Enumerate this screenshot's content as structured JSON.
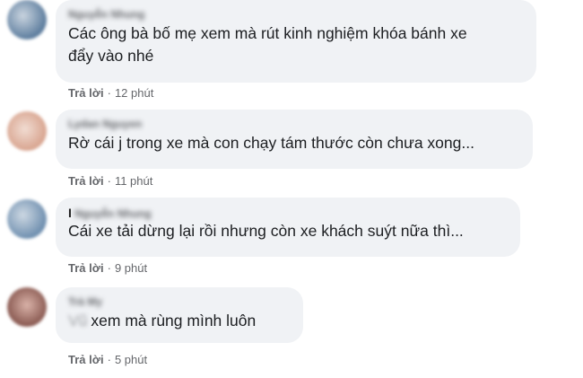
{
  "comments": [
    {
      "author": "Nguyễn Nhung",
      "text_lines": [
        "Các ông bà bố mẹ xem mà rút kinh nghiệm khóa bánh xe",
        "đẩy vào nhé"
      ],
      "reply_label": "Trả lời",
      "separator": "·",
      "time": "12 phút",
      "avatar_colors": [
        "#5d7d9e",
        "#c9d4df"
      ]
    },
    {
      "author": "Lydan Nguyen",
      "text_lines": [
        "Rờ cái j trong xe mà con chạy tám thước còn chưa xong..."
      ],
      "reply_label": "Trả lời",
      "separator": "·",
      "time": "11 phút",
      "avatar_colors": [
        "#d8a48f",
        "#f1dcd2"
      ]
    },
    {
      "author": "Nguyễn Nhung",
      "author_tag": "I",
      "text_lines": [
        "Cái xe tải dừng lại rồi nhưng còn xe khách suýt nữa thì..."
      ],
      "reply_label": "Trả lời",
      "separator": "·",
      "time": "9 phút",
      "avatar_colors": [
        "#6f8faf",
        "#cdd8e3"
      ]
    },
    {
      "author": "Trà My",
      "mention": "Vũ",
      "text_lines": [
        "xem mà rùng mình luôn"
      ],
      "reply_label": "Trả lời",
      "separator": "·",
      "time": "5 phút",
      "avatar_colors": [
        "#8a5a52",
        "#d9b2a8"
      ]
    }
  ]
}
